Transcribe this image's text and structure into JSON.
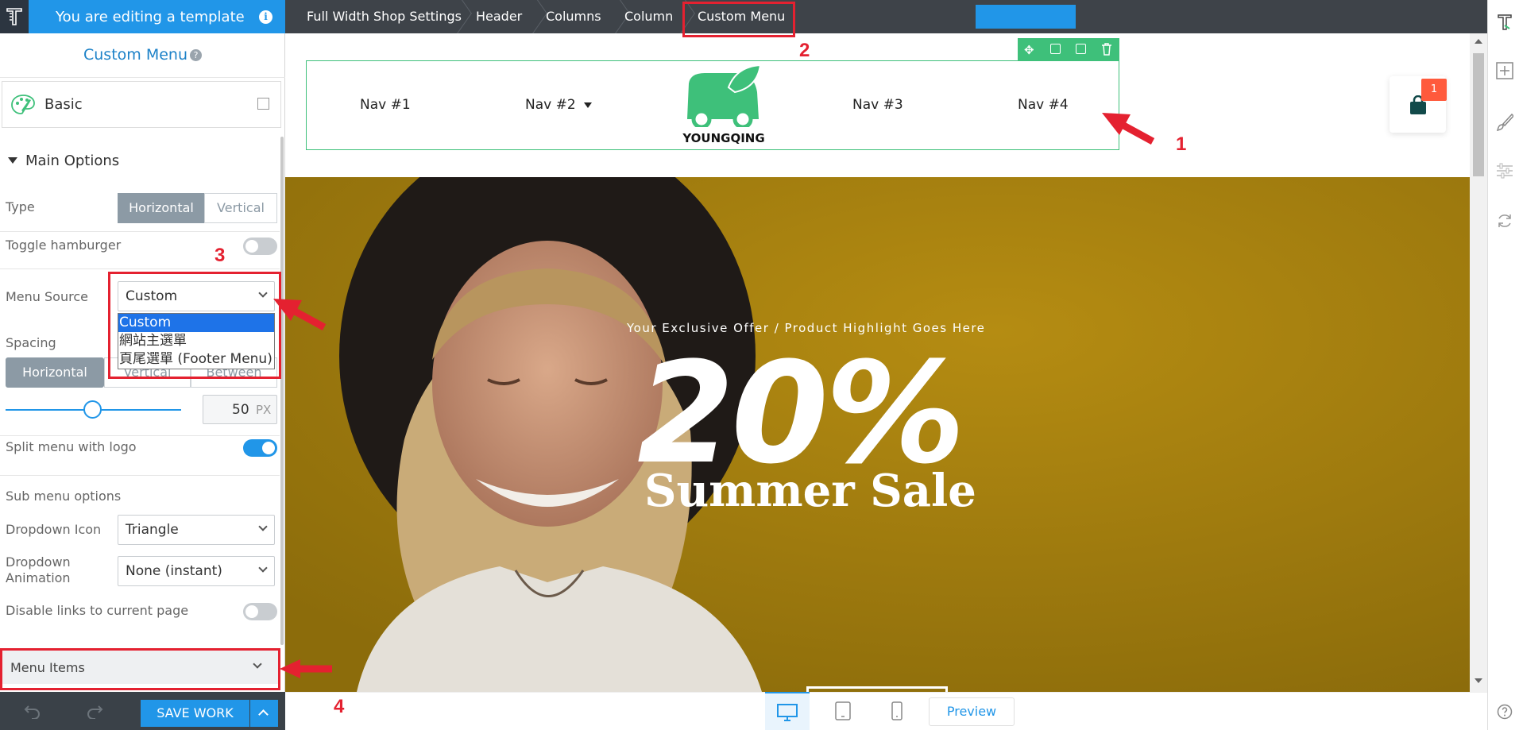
{
  "topbar": {
    "title": "You are editing a template",
    "info_icon": "i"
  },
  "panel": {
    "title": "Custom Menu",
    "help_icon": "?",
    "basic_label": "Basic",
    "main_options_label": "Main Options",
    "type_label": "Type",
    "type_options": [
      "Horizontal",
      "Vertical"
    ],
    "type_selected": "Horizontal",
    "toggle_hamburger_label": "Toggle hamburger",
    "toggle_hamburger_on": false,
    "menu_source_label": "Menu Source",
    "menu_source_value": "Custom",
    "menu_source_options": [
      "Custom",
      "網站主選單",
      "頁尾選單 (Footer Menu)"
    ],
    "spacing_label": "Spacing",
    "spacing_tabs": [
      "Horizontal",
      "Vertical",
      "Between"
    ],
    "spacing_value": "50",
    "spacing_unit": "PX",
    "split_label": "Split menu with logo",
    "split_on": true,
    "sub_menu_label": "Sub menu options",
    "dropdown_icon_label": "Dropdown Icon",
    "dropdown_icon_value": "Triangle",
    "dropdown_anim_label_1": "Dropdown",
    "dropdown_anim_label_2": "Animation",
    "dropdown_anim_value": "None (instant)",
    "disable_links_label": "Disable links to current page",
    "disable_links_on": false,
    "menu_items_label": "Menu Items"
  },
  "bottom": {
    "save_label": "SAVE WORK"
  },
  "breadcrumbs": [
    "Full Width Shop Settings",
    "Header",
    "Columns",
    "Column",
    "Custom Menu"
  ],
  "nav": {
    "items": [
      "Nav #1",
      "Nav #2",
      "Nav #3",
      "Nav #4"
    ],
    "logo_text": "YOUNGQING"
  },
  "cart": {
    "badge": "1"
  },
  "hero": {
    "kicker": "Your Exclusive Offer / Product Highlight Goes Here",
    "big": "20%",
    "headline": "Summer Sale"
  },
  "devices": {
    "preview_label": "Preview"
  },
  "annotations": {
    "n1": "1",
    "n2": "2",
    "n3": "3",
    "n4": "4"
  },
  "colors": {
    "accent": "#2196e8",
    "dark": "#3e4349",
    "hero": "#aa8410",
    "logo_green": "#3ec07a",
    "annotation": "#e42130",
    "badge": "#ff5a3c"
  }
}
